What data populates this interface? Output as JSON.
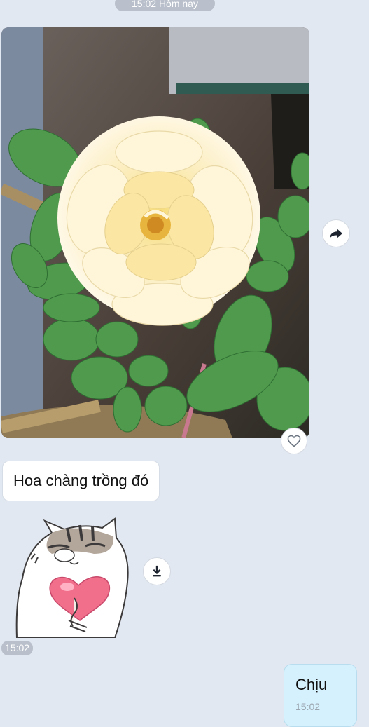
{
  "header": {
    "date_chip": "15:02 Hôm nay"
  },
  "messages": {
    "photo": {
      "description_icon": "rose-photo"
    },
    "text_in": "Hoa chàng trồng đó",
    "sticker": {
      "time": "15:02"
    },
    "text_out": {
      "text": "Chịu",
      "time": "15:02"
    }
  },
  "icons": {
    "forward": "forward-icon",
    "like": "heart-outline-icon",
    "download": "download-icon"
  },
  "colors": {
    "background": "#e2e8f1",
    "bubble_in": "#ffffff",
    "bubble_out": "#d5f1fd",
    "chip": "#b9c0cb"
  }
}
